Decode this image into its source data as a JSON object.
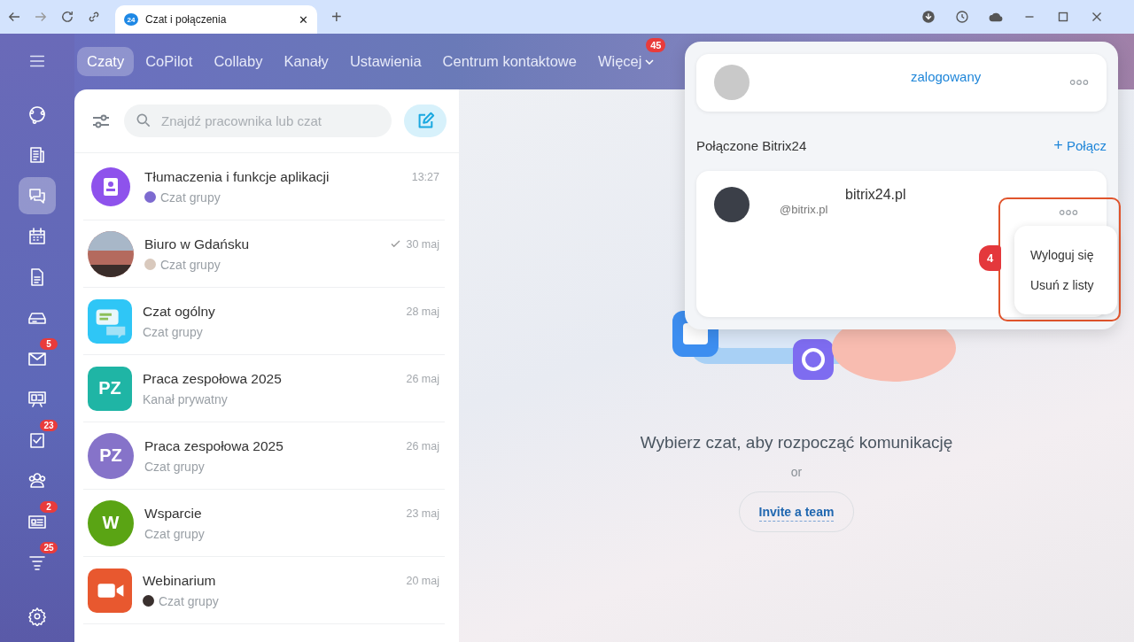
{
  "browser": {
    "tab": {
      "icon_text": "24",
      "title": "Czat i połączenia",
      "close": "✕"
    },
    "new_tab": "+"
  },
  "nav": {
    "tabs": [
      {
        "label": "Czaty",
        "selected": true
      },
      {
        "label": "CoPilot",
        "selected": false
      },
      {
        "label": "Collaby",
        "selected": false
      },
      {
        "label": "Kanały",
        "selected": false
      },
      {
        "label": "Ustawienia",
        "selected": false
      },
      {
        "label": "Centrum kontaktowe",
        "selected": false
      },
      {
        "label": "Więcej",
        "selected": false,
        "badge": "45",
        "dropdown": true
      }
    ]
  },
  "rail": {
    "items": [
      {
        "selected": false
      },
      {
        "selected": false
      },
      {
        "selected": true
      },
      {
        "selected": false
      },
      {
        "selected": false
      },
      {
        "selected": false
      },
      {
        "selected": false,
        "badge": "5"
      },
      {
        "selected": false
      },
      {
        "selected": false,
        "badge": "23"
      },
      {
        "selected": false
      },
      {
        "selected": false,
        "badge": "2"
      },
      {
        "selected": false,
        "badge": "25"
      }
    ]
  },
  "chat_list": {
    "search": {
      "placeholder": "Znajdź pracownika lub czat"
    },
    "chats": [
      {
        "name": "Tłumaczenia i funkcje aplikacji",
        "subtitle": "Czat grupy",
        "date": "13:27",
        "read": false,
        "avatar": {
          "kind": "icon",
          "color": "#8e52ec"
        },
        "sub_avatar": {
          "color": "#7d6ad0"
        }
      },
      {
        "name": "Biuro w Gdańsku",
        "subtitle": "Czat grupy",
        "date": "30 maj",
        "read": true,
        "avatar": {
          "kind": "photo",
          "color": "#b46a5e"
        },
        "sub_avatar": {
          "color": "#d9c9bd"
        }
      },
      {
        "name": "Czat ogólny",
        "subtitle": "Czat grupy",
        "date": "28 maj",
        "read": false,
        "avatar": {
          "kind": "app",
          "color": "#2fc6f6"
        }
      },
      {
        "name": "Praca zespołowa 2025",
        "subtitle": "Kanał prywatny",
        "date": "26 maj",
        "read": false,
        "avatar": {
          "kind": "tile",
          "text": "PZ",
          "color": "#1fb5a5"
        }
      },
      {
        "name": "Praca zespołowa 2025",
        "subtitle": "Czat grupy",
        "date": "26 maj",
        "read": false,
        "avatar": {
          "kind": "initials",
          "text": "PZ",
          "color": "#8673c9"
        }
      },
      {
        "name": "Wsparcie",
        "subtitle": "Czat grupy",
        "date": "23 maj",
        "read": false,
        "avatar": {
          "kind": "initials",
          "text": "W",
          "color": "#5aa414"
        }
      },
      {
        "name": "Webinarium",
        "subtitle": "Czat grupy",
        "date": "20 maj",
        "read": false,
        "avatar": {
          "kind": "video",
          "color": "#e8582f"
        },
        "sub_avatar": {
          "color": "#3a302e"
        }
      }
    ]
  },
  "empty_state": {
    "message": "Wybierz czat, aby rozpocząć komunikację",
    "or": "or",
    "invite": "Invite a team"
  },
  "accounts_popup": {
    "current": {
      "status": "zalogowany"
    },
    "section_title": "Połączone Bitrix24",
    "connect": {
      "icon": "+",
      "label": "Połącz"
    },
    "connected": {
      "name": "bitrix24.pl",
      "login": "@bitrix.pl",
      "menu": [
        "Wyloguj się",
        "Usuń z listy"
      ]
    },
    "step": "4"
  }
}
